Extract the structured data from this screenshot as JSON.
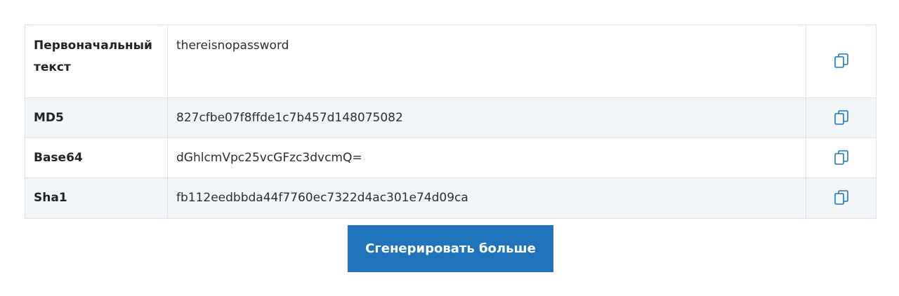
{
  "rows": [
    {
      "label": "Первоначальный текст",
      "value": "thereisnopassword",
      "icon": "copy-icon"
    },
    {
      "label": "MD5",
      "value": "827cfbe07f8ffde1c7b457d148075082",
      "icon": "copy-icon"
    },
    {
      "label": "Base64",
      "value": "dGhlcmVpc25vcGFzc3dvcmQ=",
      "icon": "copy-icon"
    },
    {
      "label": "Sha1",
      "value": "fb112eedbbda44f7760ec7322d4ac301e74d09ca",
      "icon": "copy-icon"
    }
  ],
  "generate_button": {
    "label": "Сгенерировать больше"
  },
  "colors": {
    "accent": "#1f74bb",
    "row_alt": "#f3f6f9",
    "border": "#dee2e6",
    "icon": "#1f74bb"
  }
}
